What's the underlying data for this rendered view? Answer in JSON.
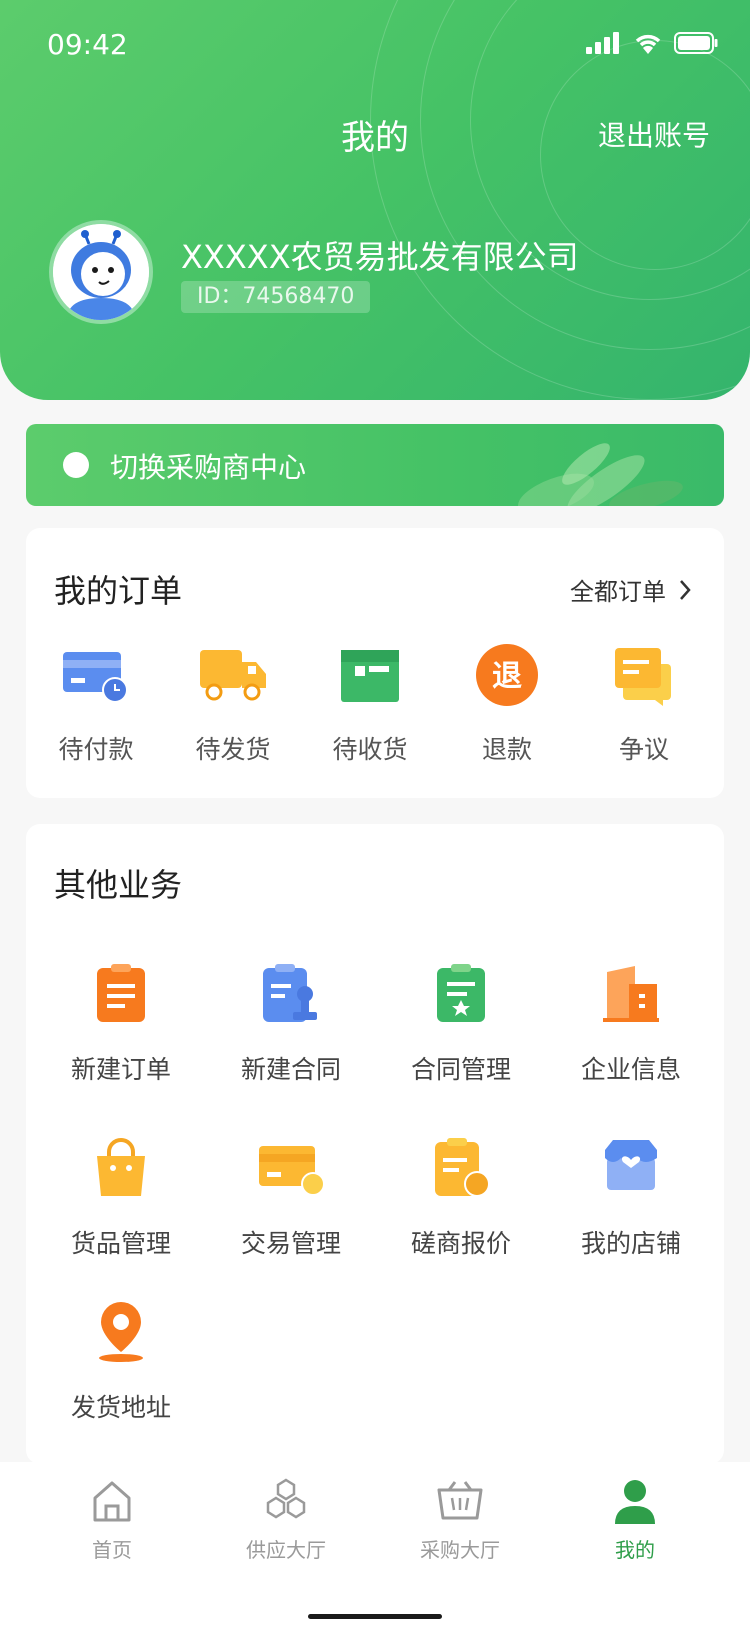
{
  "status_bar": {
    "time": "09:42"
  },
  "header": {
    "title": "我的",
    "logout_label": "退出账号",
    "company_name": "XXXXX农贸易批发有限公司",
    "user_id": "ID：74568470"
  },
  "switch_bar": {
    "label": "切换采购商中心"
  },
  "orders": {
    "title": "我的订单",
    "all_label": "全都订单",
    "items": [
      {
        "label": "待付款",
        "icon": "card-clock-icon"
      },
      {
        "label": "待发货",
        "icon": "truck-icon"
      },
      {
        "label": "待收货",
        "icon": "box-icon"
      },
      {
        "label": "退款",
        "icon": "refund-icon",
        "glyph": "退"
      },
      {
        "label": "争议",
        "icon": "chat-icon"
      }
    ]
  },
  "business": {
    "title": "其他业务",
    "items": [
      {
        "label": "新建订单",
        "icon": "clipboard-icon"
      },
      {
        "label": "新建合同",
        "icon": "contract-stamp-icon"
      },
      {
        "label": "合同管理",
        "icon": "clipboard-star-icon"
      },
      {
        "label": "企业信息",
        "icon": "building-icon"
      },
      {
        "label": "货品管理",
        "icon": "shopping-bag-icon"
      },
      {
        "label": "交易管理",
        "icon": "card-coin-icon"
      },
      {
        "label": "磋商报价",
        "icon": "clipboard-coin-icon"
      },
      {
        "label": "我的店铺",
        "icon": "store-heart-icon"
      },
      {
        "label": "发货地址",
        "icon": "location-pin-icon"
      }
    ]
  },
  "tabbar": {
    "items": [
      {
        "label": "首页",
        "icon": "home-icon"
      },
      {
        "label": "供应大厅",
        "icon": "hexagons-icon"
      },
      {
        "label": "采购大厅",
        "icon": "basket-icon"
      },
      {
        "label": "我的",
        "icon": "user-icon",
        "active": true
      }
    ]
  },
  "colors": {
    "brand_green": "#45c266",
    "active_tab": "#2f9e4a",
    "orange": "#f77a1e",
    "blue": "#5b8def"
  }
}
